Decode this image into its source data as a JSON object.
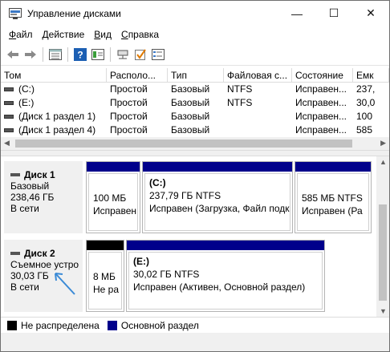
{
  "window": {
    "title": "Управление дисками",
    "minimize": "—",
    "maximize": "☐",
    "close": "✕"
  },
  "menu": [
    {
      "key": "Ф",
      "rest": "айл"
    },
    {
      "key": "Д",
      "rest": "ействие"
    },
    {
      "key": "В",
      "rest": "ид"
    },
    {
      "key": "С",
      "rest": "правка"
    }
  ],
  "volumes": {
    "headers": [
      "Том",
      "Располо...",
      "Тип",
      "Файловая с...",
      "Состояние",
      "Емк"
    ],
    "rows": [
      [
        "(C:)",
        "Простой",
        "Базовый",
        "NTFS",
        "Исправен...",
        "237,"
      ],
      [
        "(E:)",
        "Простой",
        "Базовый",
        "NTFS",
        "Исправен...",
        "30,0"
      ],
      [
        "(Диск 1 раздел 1)",
        "Простой",
        "Базовый",
        "",
        "Исправен...",
        "100"
      ],
      [
        "(Диск 1 раздел 4)",
        "Простой",
        "Базовый",
        "",
        "Исправен...",
        "585"
      ]
    ]
  },
  "disks": [
    {
      "name": "Диск 1",
      "type": "Базовый",
      "size": "238,46 ГБ",
      "status": "В сети",
      "partitions": [
        {
          "label": "",
          "size": "100 МБ",
          "state": "Исправен"
        },
        {
          "label": "(C:)",
          "size": "237,79 ГБ NTFS",
          "state": "Исправен (Загрузка, Файл подк"
        },
        {
          "label": "",
          "size": "585 МБ NTFS",
          "state": "Исправен (Ра"
        }
      ]
    },
    {
      "name": "Диск 2",
      "type": "Съемное устро",
      "size": "30,03 ГБ",
      "status": "В сети",
      "partitions": [
        {
          "label": "",
          "size": "8 МБ",
          "state": "Не ра"
        },
        {
          "label": "(E:)",
          "size": "30,02 ГБ NTFS",
          "state": "Исправен (Активен, Основной раздел)"
        }
      ]
    }
  ],
  "legend": [
    {
      "label": "Не распределена",
      "color": "#000000"
    },
    {
      "label": "Основной раздел",
      "color": "#00008b"
    }
  ]
}
